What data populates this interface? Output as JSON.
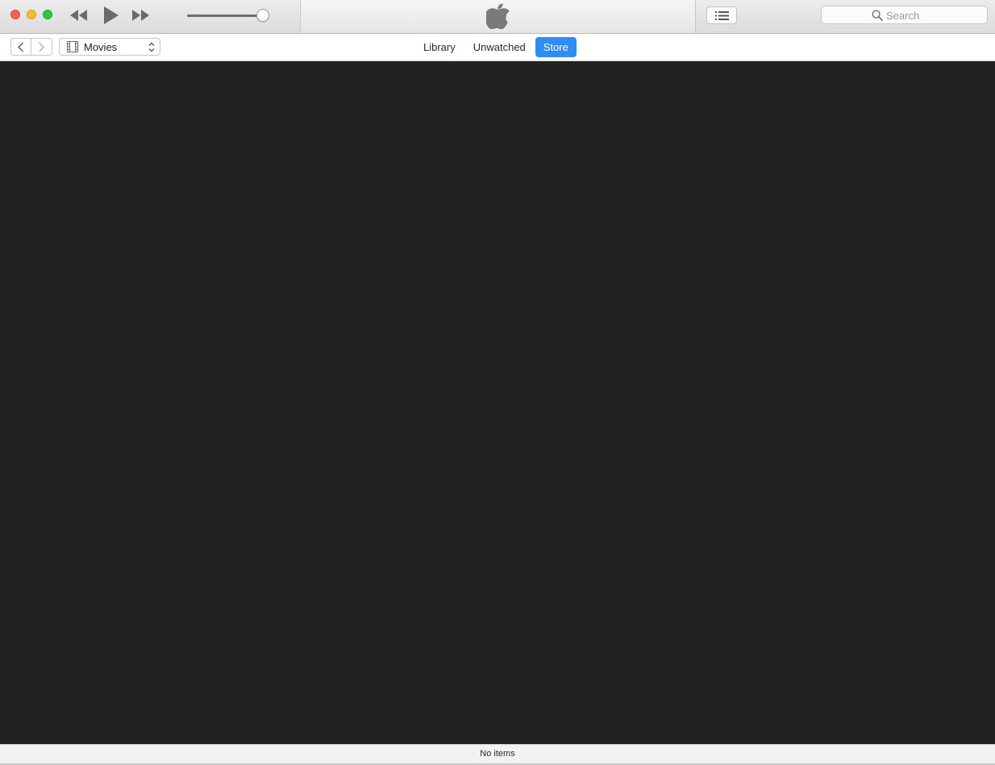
{
  "window": {
    "controls": [
      "close",
      "minimize",
      "zoom"
    ]
  },
  "player": {
    "buttons": [
      "rewind-icon",
      "play-icon",
      "fast-forward-icon"
    ],
    "volume_level": 0.98,
    "center_icon": "apple-logo"
  },
  "toolbar": {
    "list_button_icon": "list-icon",
    "search": {
      "placeholder": "Search",
      "value": ""
    }
  },
  "nav": {
    "back_icon": "chevron-left-icon",
    "forward_icon": "chevron-right-icon",
    "media_select": {
      "icon": "film-icon",
      "selected": "Movies"
    }
  },
  "tabs": [
    {
      "label": "Library",
      "active": false
    },
    {
      "label": "Unwatched",
      "active": false
    },
    {
      "label": "Store",
      "active": true
    }
  ],
  "colors": {
    "accent": "#2f8cf2",
    "content_background": "#222222",
    "close": "#fc5f57",
    "minimize": "#fdbc2e",
    "zoom": "#29c840"
  },
  "status": {
    "text": "No items"
  }
}
